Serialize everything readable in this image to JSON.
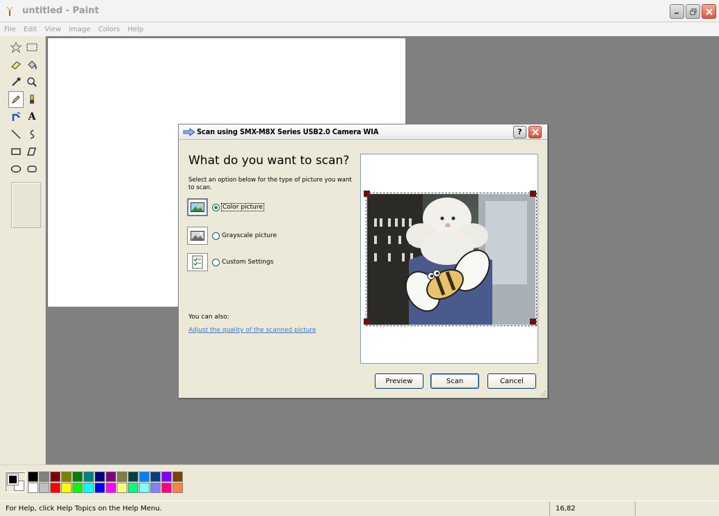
{
  "window": {
    "title": "untitled - Paint",
    "menu": [
      "File",
      "Edit",
      "View",
      "Image",
      "Colors",
      "Help"
    ]
  },
  "toolbox": {
    "tools": [
      {
        "name": "free-form-select",
        "icon": "star-select-icon",
        "glyph": "⟡"
      },
      {
        "name": "select",
        "icon": "rect-select-icon",
        "glyph": "⬚"
      },
      {
        "name": "eraser",
        "icon": "eraser-icon",
        "glyph": ""
      },
      {
        "name": "fill",
        "icon": "paint-bucket-icon",
        "glyph": ""
      },
      {
        "name": "pick-color",
        "icon": "eyedropper-icon",
        "glyph": ""
      },
      {
        "name": "magnifier",
        "icon": "magnifier-icon",
        "glyph": ""
      },
      {
        "name": "pencil",
        "icon": "pencil-icon",
        "glyph": ""
      },
      {
        "name": "brush",
        "icon": "brush-icon",
        "glyph": ""
      },
      {
        "name": "airbrush",
        "icon": "airbrush-icon",
        "glyph": ""
      },
      {
        "name": "text",
        "icon": "text-icon",
        "glyph": "A"
      },
      {
        "name": "line",
        "icon": "line-icon",
        "glyph": "＼"
      },
      {
        "name": "curve",
        "icon": "curve-icon",
        "glyph": "∂"
      },
      {
        "name": "rectangle",
        "icon": "rectangle-icon",
        "glyph": "▭"
      },
      {
        "name": "polygon",
        "icon": "polygon-icon",
        "glyph": "⏢"
      },
      {
        "name": "ellipse",
        "icon": "ellipse-icon",
        "glyph": "⬭"
      },
      {
        "name": "rounded-rectangle",
        "icon": "rounded-rect-icon",
        "glyph": "▢"
      }
    ],
    "active_tool": "pencil"
  },
  "palette": {
    "foreground": "#000000",
    "background": "#ffffff",
    "row1": [
      "#000000",
      "#808080",
      "#800000",
      "#808000",
      "#008000",
      "#008080",
      "#000080",
      "#800080",
      "#808040",
      "#004040",
      "#0080ff",
      "#004080",
      "#8000ff",
      "#804000"
    ],
    "row2": [
      "#ffffff",
      "#c0c0c0",
      "#ff0000",
      "#ffff00",
      "#00ff00",
      "#00ffff",
      "#0000ff",
      "#ff00ff",
      "#ffff80",
      "#00ff80",
      "#80ffff",
      "#8080ff",
      "#ff0080",
      "#ff8040"
    ]
  },
  "status": {
    "help_text": "For Help, click Help Topics on the Help Menu.",
    "coords": "16,82"
  },
  "dialog": {
    "title": "Scan using SMX-M8X Series USB2.0 Camera WIA",
    "heading": "What do you want to scan?",
    "instructions": "Select an option below for the type of picture you want to scan.",
    "options": [
      {
        "label": "Color picture",
        "selected": true
      },
      {
        "label": "Grayscale picture",
        "selected": false
      },
      {
        "label": "Custom Settings",
        "selected": false
      }
    ],
    "also_label": "You can also:",
    "link": "Adjust the quality of the scanned picture",
    "buttons": {
      "preview": "Preview",
      "scan": "Scan",
      "cancel": "Cancel"
    },
    "help_glyph": "?"
  }
}
